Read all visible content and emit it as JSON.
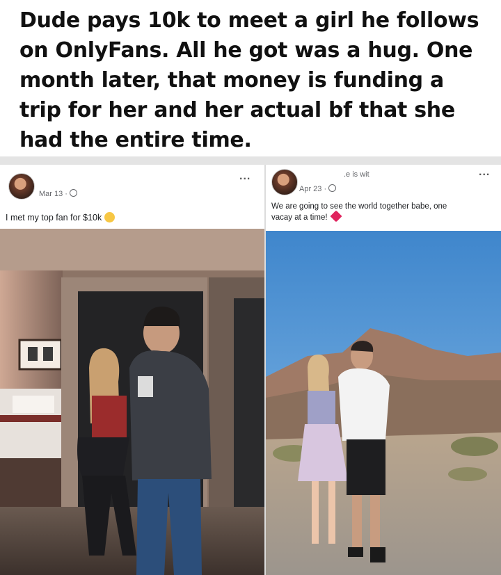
{
  "headline": "Dude pays 10k to meet a girl he follows on OnlyFans. All he got was a hug. One month later, that money is funding a trip for her and her actual bf that she had the entire time.",
  "left_post": {
    "date": "Mar 13 ·",
    "menu": "...",
    "caption": "I met my top fan for $10k"
  },
  "right_post": {
    "header_fragment": ".e is wit",
    "date": "Apr 23 ·",
    "menu": "...",
    "caption_line1": "We are going to see the world together babe, one",
    "caption_line2": "vacay at a time!"
  },
  "colors": {
    "separator": "#e4e4e4",
    "text": "#111111",
    "meta": "#65676b"
  }
}
